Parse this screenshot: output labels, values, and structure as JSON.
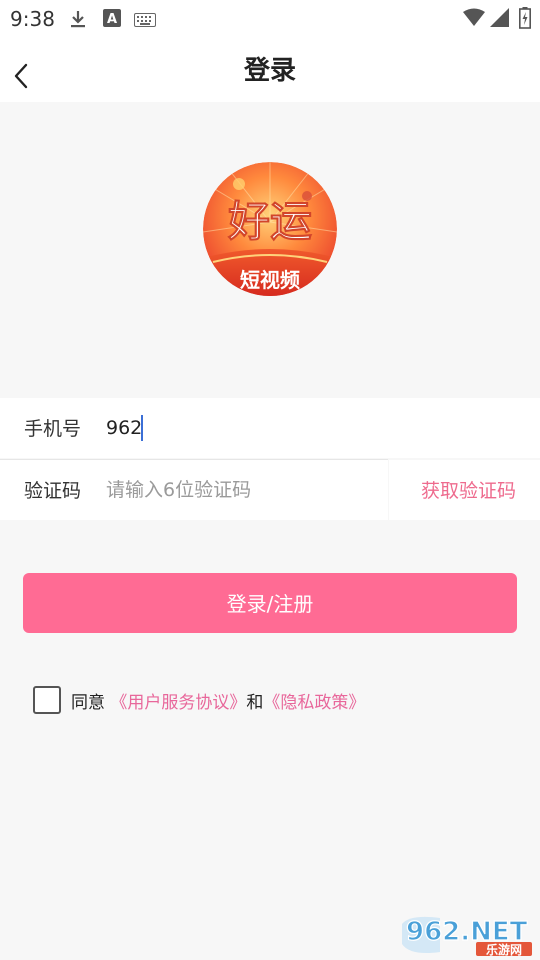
{
  "status_bar": {
    "time": "9:38",
    "icons": [
      "download-icon",
      "font-a-icon",
      "keyboard-icon",
      "wifi-icon",
      "signal-icon",
      "battery-icon"
    ]
  },
  "header": {
    "title": "登录",
    "back_icon": "chevron-left-icon"
  },
  "logo": {
    "main_text": "好运",
    "sub_text": "短视频"
  },
  "form": {
    "phone_label": "手机号",
    "phone_value": "962",
    "code_label": "验证码",
    "code_placeholder": "请输入6位验证码",
    "get_code_label": "获取验证码"
  },
  "login_button": "登录/注册",
  "agreement": {
    "prefix": "同意",
    "user_agreement": "《用户服务协议》",
    "and": "和",
    "privacy_policy": "《隐私政策》",
    "checked": false
  },
  "watermark": {
    "main": "962.NET",
    "sub": "乐游网"
  },
  "colors": {
    "accent": "#ff6b94",
    "link": "#e8679b",
    "get_code": "#ee6b8e",
    "background": "#f7f7f7"
  }
}
